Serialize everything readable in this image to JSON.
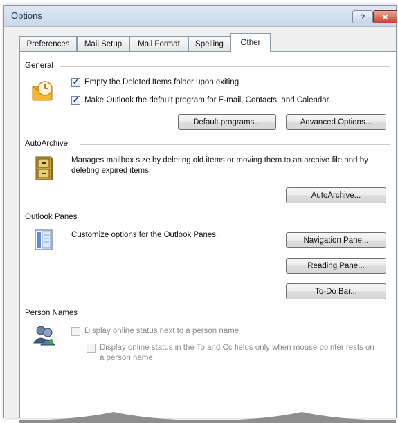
{
  "window": {
    "title": "Options",
    "help_label": "?",
    "close_label": "✕"
  },
  "tabs": [
    {
      "label": "Preferences",
      "active": false
    },
    {
      "label": "Mail Setup",
      "active": false
    },
    {
      "label": "Mail Format",
      "active": false
    },
    {
      "label": "Spelling",
      "active": false
    },
    {
      "label": "Other",
      "active": true
    }
  ],
  "general": {
    "heading": "General",
    "icon": "outlook-clock-icon",
    "empty_deleted": {
      "label": "Empty the Deleted Items folder upon exiting",
      "checked": true
    },
    "default_program": {
      "label": "Make Outlook the default program for E-mail, Contacts, and Calendar.",
      "checked": true
    },
    "default_programs_button": "Default programs...",
    "advanced_options_button": "Advanced Options..."
  },
  "autoarchive": {
    "heading": "AutoArchive",
    "icon": "archive-cabinet-icon",
    "description": "Manages mailbox size by deleting old items or moving them to an archive file and by deleting expired items.",
    "button": "AutoArchive..."
  },
  "panes": {
    "heading": "Outlook Panes",
    "icon": "panes-layout-icon",
    "description": "Customize options for the Outlook Panes.",
    "navigation_button": "Navigation Pane...",
    "reading_button": "Reading Pane...",
    "todo_button": "To-Do Bar..."
  },
  "person_names": {
    "heading": "Person Names",
    "icon": "people-icon",
    "online_status": {
      "label": "Display online status next to a person name",
      "checked": false,
      "enabled": false
    },
    "online_status_to_cc": {
      "label": "Display online status in the To and Cc fields only when mouse pointer rests on a person name",
      "checked": false,
      "enabled": false
    }
  },
  "colors": {
    "titlebar": "#c9d8ea",
    "close": "#c9432f",
    "disabled_text": "#8c8c8c"
  }
}
